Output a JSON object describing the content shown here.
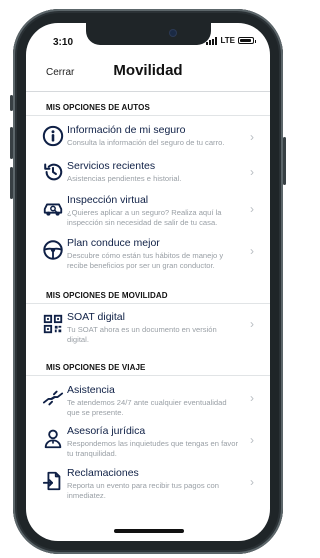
{
  "status_bar": {
    "time": "3:10",
    "network": "LTE"
  },
  "header": {
    "cancel_label": "Cerrar",
    "title": "Movilidad"
  },
  "sections": {
    "autos": "MIS OPCIONES DE AUTOS",
    "movilidad": "MIS OPCIONES DE MOVILIDAD",
    "viaje": "MIS OPCIONES DE VIAJE"
  },
  "items": [
    {
      "icon": "info-icon",
      "title": "Información de mi seguro",
      "description": "Consulta la información del seguro de tu carro."
    },
    {
      "icon": "history-icon",
      "title": "Servicios recientes",
      "description": "Asistencias pendientes e historial."
    },
    {
      "icon": "car-inspection-icon",
      "title": "Inspección virtual",
      "description": "¿Quieres aplicar a un seguro? Realiza aquí la inspección sin necesidad de salir de tu casa."
    },
    {
      "icon": "steering-wheel-icon",
      "title": "Plan conduce mejor",
      "description": "Descubre cómo están tus hábitos de manejo y recibe beneficios por ser un gran conductor."
    },
    {
      "icon": "qr-code-icon",
      "title": "SOAT digital",
      "description": "Tu SOAT ahora es un documento en versión digital."
    },
    {
      "icon": "assistance-icon",
      "title": "Asistencia",
      "description": "Te atendemos 24/7 ante cualquier eventualidad que se presente."
    },
    {
      "icon": "legal-advisor-icon",
      "title": "Asesoría jurídica",
      "description": "Respondemos las inquietudes que tengas en favor tu tranquilidad."
    },
    {
      "icon": "claims-icon",
      "title": "Reclamaciones",
      "description": "Reporta un evento para recibir tus pagos con inmediatez."
    }
  ],
  "colors": {
    "icon": "#0f2046",
    "section_text": "#111111",
    "description": "#9aa0a6",
    "chevron": "#b8bdc2"
  }
}
